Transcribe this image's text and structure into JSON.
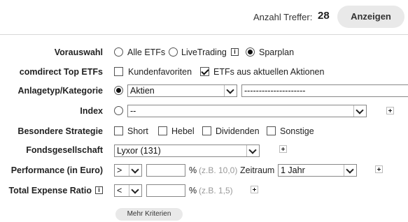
{
  "header": {
    "hits_label": "Anzahl Treffer:",
    "hits_count": "28",
    "show_button": "Anzeigen"
  },
  "preselection": {
    "label": "Vorauswahl",
    "options": [
      {
        "label": "Alle ETFs",
        "selected": false
      },
      {
        "label": "LiveTrading",
        "selected": false
      },
      {
        "label": "Sparplan",
        "selected": true
      }
    ],
    "info_icon": "i"
  },
  "top_etfs": {
    "label": "comdirect Top ETFs",
    "options": [
      {
        "label": "Kundenfavoriten",
        "checked": false
      },
      {
        "label": "ETFs aus aktuellen Aktionen",
        "checked": true
      }
    ]
  },
  "category": {
    "label": "Anlagetyp/Kategorie",
    "select_value": "Aktien",
    "sub_value": "---------------------"
  },
  "index": {
    "label": "Index",
    "select_value": "--"
  },
  "strategy": {
    "label": "Besondere Strategie",
    "options": [
      {
        "label": "Short",
        "checked": false
      },
      {
        "label": "Hebel",
        "checked": false
      },
      {
        "label": "Dividenden",
        "checked": false
      },
      {
        "label": "Sonstige",
        "checked": false
      }
    ]
  },
  "fund_company": {
    "label": "Fondsgesellschaft",
    "select_value": "Lyxor (131)"
  },
  "performance": {
    "label": "Performance (in Euro)",
    "operator": ">",
    "value": "",
    "unit": "%",
    "hint": "(z.B. 10,0)",
    "period_label": "Zeitraum",
    "period_value": "1 Jahr"
  },
  "ter": {
    "label": "Total Expense Ratio",
    "info_icon": "i",
    "operator": "<",
    "value": "",
    "unit": "%",
    "hint": "(z.B. 1,5)"
  },
  "more_button": "Mehr Kriterien",
  "icons": {
    "plus": "plus-icon",
    "info": "info-icon",
    "dropdown": "chevron-down-icon"
  }
}
